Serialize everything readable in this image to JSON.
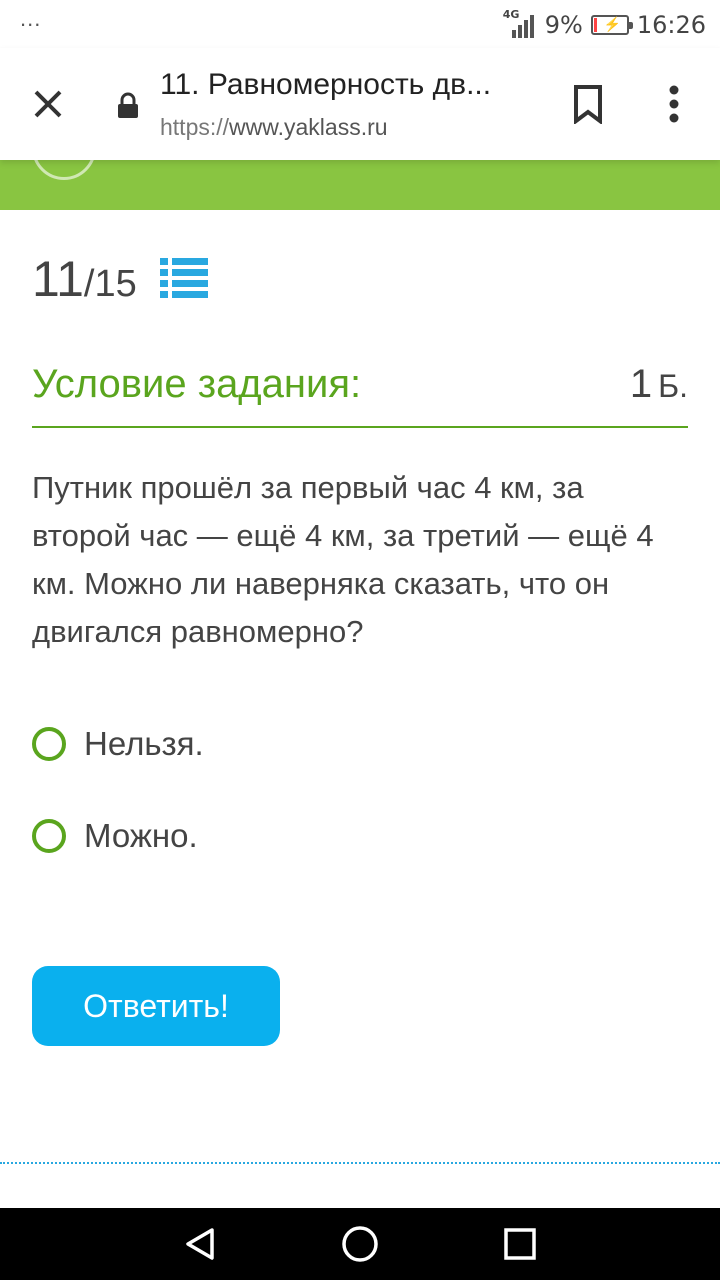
{
  "status_bar": {
    "dots": "...",
    "network": "4G",
    "battery_percent": "9%",
    "battery_level": 0.09,
    "time": "16:26"
  },
  "browser": {
    "tab_title": "11. Равномерность дв...",
    "url_scheme": "https://",
    "url_host": "www.yaklass.ru"
  },
  "task": {
    "current": "11",
    "separator": "/",
    "total": "15",
    "condition_title": "Условие задания:",
    "points_value": "1",
    "points_unit": "Б.",
    "text": "Путник прошёл за первый час 4 км, за второй час — ещё 4 км, за третий — ещё 4 км. Можно ли наверняка сказать, что он двигался равномерно?",
    "options": [
      {
        "label": "Нельзя."
      },
      {
        "label": "Можно."
      }
    ],
    "answer_button": "Ответить!"
  },
  "colors": {
    "accent_green": "#5aa51e",
    "band_green": "#89c541",
    "button_blue": "#0ab0ee"
  }
}
